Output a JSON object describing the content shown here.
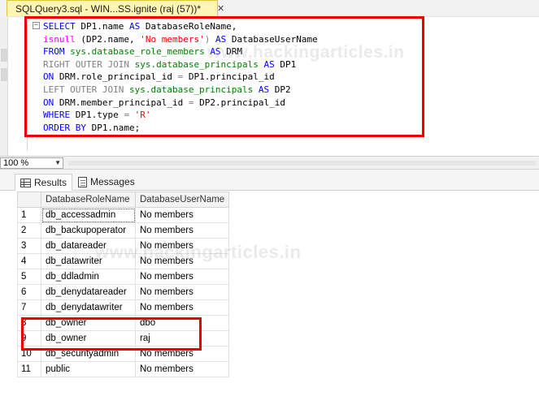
{
  "tab": {
    "title": "SQLQuery3.sql - WIN...SS.ignite (raj (57))*",
    "close": "✕"
  },
  "editor": {
    "lines": [
      [
        {
          "t": "SELECT ",
          "c": "kw"
        },
        {
          "t": "DP1.name ",
          "c": ""
        },
        {
          "t": "AS ",
          "c": "kw"
        },
        {
          "t": "DatabaseRoleName,",
          "c": ""
        }
      ],
      [
        {
          "t": "isnull ",
          "c": "fn"
        },
        {
          "t": "(DP2.name, ",
          "c": ""
        },
        {
          "t": "'No members'",
          "c": "str"
        },
        {
          "t": ") ",
          "c": "gray"
        },
        {
          "t": "AS ",
          "c": "kw"
        },
        {
          "t": "DatabaseUserName",
          "c": ""
        }
      ],
      [
        {
          "t": "FROM ",
          "c": "kw"
        },
        {
          "t": "sys.database_role_members ",
          "c": "sys"
        },
        {
          "t": "AS ",
          "c": "kw"
        },
        {
          "t": "DRM",
          "c": ""
        }
      ],
      [
        {
          "t": "RIGHT OUTER JOIN ",
          "c": "gray"
        },
        {
          "t": "sys.database_principals ",
          "c": "sys"
        },
        {
          "t": "AS ",
          "c": "kw"
        },
        {
          "t": "DP1",
          "c": ""
        }
      ],
      [
        {
          "t": "ON ",
          "c": "kw"
        },
        {
          "t": "DRM.role_principal_id ",
          "c": ""
        },
        {
          "t": "= ",
          "c": "gray"
        },
        {
          "t": "DP1.principal_id",
          "c": ""
        }
      ],
      [
        {
          "t": "LEFT OUTER JOIN ",
          "c": "gray"
        },
        {
          "t": "sys.database_principals ",
          "c": "sys"
        },
        {
          "t": "AS ",
          "c": "kw"
        },
        {
          "t": "DP2",
          "c": ""
        }
      ],
      [
        {
          "t": "ON ",
          "c": "kw"
        },
        {
          "t": "DRM.member_principal_id ",
          "c": ""
        },
        {
          "t": "= ",
          "c": "gray"
        },
        {
          "t": "DP2.principal_id",
          "c": ""
        }
      ],
      [
        {
          "t": "WHERE ",
          "c": "kw"
        },
        {
          "t": "DP1.type ",
          "c": ""
        },
        {
          "t": "= ",
          "c": "gray"
        },
        {
          "t": "'R'",
          "c": "str"
        }
      ],
      [
        {
          "t": "ORDER BY ",
          "c": "kw"
        },
        {
          "t": "DP1.name;",
          "c": ""
        }
      ]
    ],
    "watermark": "www.hackingarticles.in"
  },
  "zoom": {
    "value": "100 %"
  },
  "results_tabs": [
    {
      "label": "Results",
      "active": true
    },
    {
      "label": "Messages",
      "active": false
    }
  ],
  "grid": {
    "columns": [
      "DatabaseRoleName",
      "DatabaseUserName"
    ],
    "rows": [
      [
        "1",
        "db_accessadmin",
        "No members"
      ],
      [
        "2",
        "db_backupoperator",
        "No members"
      ],
      [
        "3",
        "db_datareader",
        "No members"
      ],
      [
        "4",
        "db_datawriter",
        "No members"
      ],
      [
        "5",
        "db_ddladmin",
        "No members"
      ],
      [
        "6",
        "db_denydatareader",
        "No members"
      ],
      [
        "7",
        "db_denydatawriter",
        "No members"
      ],
      [
        "8",
        "db_owner",
        "dbo"
      ],
      [
        "9",
        "db_owner",
        "raj"
      ],
      [
        "10",
        "db_securityadmin",
        "No members"
      ],
      [
        "11",
        "public",
        "No members"
      ]
    ],
    "watermark": "www.hackingarticles.in"
  },
  "colors": {
    "highlight_box": "#ee0000",
    "tab_bg": "#fff6b3"
  }
}
